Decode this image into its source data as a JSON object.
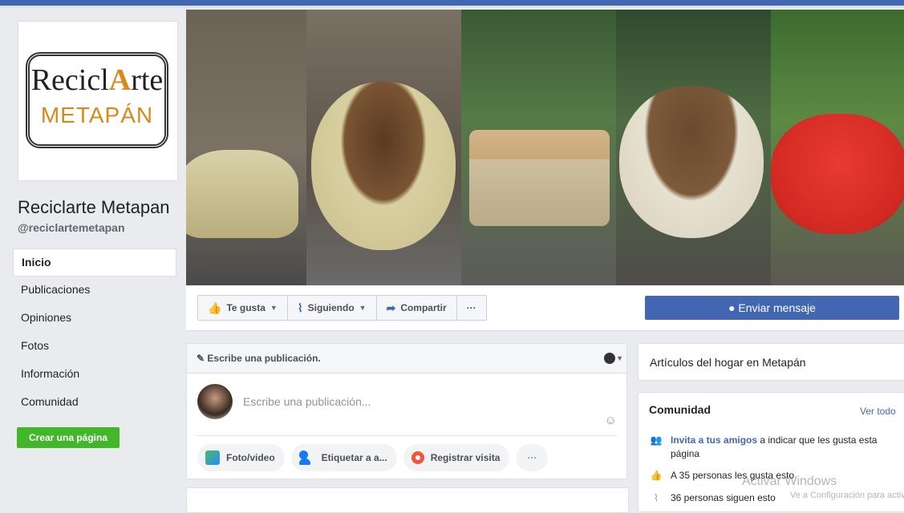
{
  "page": {
    "logo_line1_a": "Recicl",
    "logo_line1_b": "A",
    "logo_line1_c": "rte",
    "logo_line2": "METAPÁN",
    "name": "Reciclarte Metapan",
    "handle": "@reciclartemetapan"
  },
  "nav": {
    "items": [
      {
        "label": "Inicio"
      },
      {
        "label": "Publicaciones"
      },
      {
        "label": "Opiniones"
      },
      {
        "label": "Fotos"
      },
      {
        "label": "Información"
      },
      {
        "label": "Comunidad"
      }
    ],
    "create_label": "Crear una página"
  },
  "actions": {
    "like_label": "Te gusta",
    "follow_label": "Siguiendo",
    "share_label": "Compartir",
    "more_label": "···",
    "message_label": "Enviar mensaje"
  },
  "composer": {
    "header": "Escribe una publicación.",
    "placeholder": "Escribe una publicación...",
    "chips": [
      {
        "label": "Foto/video"
      },
      {
        "label": "Etiquetar a a..."
      },
      {
        "label": "Registrar visita"
      }
    ],
    "more_label": "···"
  },
  "right": {
    "category": "Artículos del hogar en Metapán",
    "community_title": "Comunidad",
    "community_link": "Ver todo",
    "invite_link": "Invita a tus amigos",
    "invite_rest": " a indicar que les gusta esta página",
    "likes_text": "A 35 personas les gusta esto",
    "follows_text": "36 personas siguen esto"
  },
  "overlay": {
    "activate": "Activar Windows",
    "activate_sub": "Ve a Configuración para activar Wi"
  },
  "colors": {
    "brand": "#4267b2",
    "create_button": "#42b72a",
    "logo_accent": "#d8891c"
  }
}
